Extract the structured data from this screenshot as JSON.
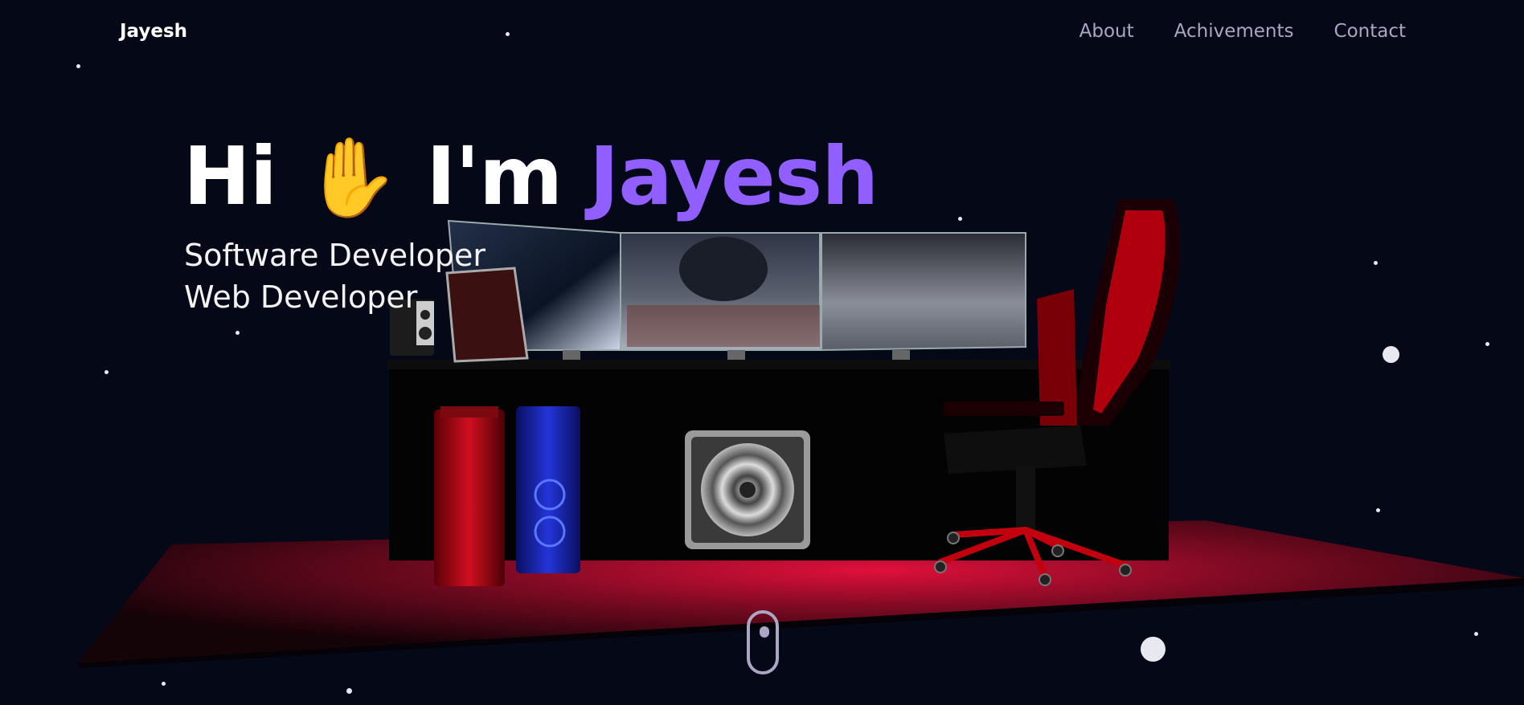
{
  "nav": {
    "logo": "Jayesh",
    "links": [
      "About",
      "Achivements",
      "Contact"
    ]
  },
  "hero": {
    "greeting": "Hi",
    "wave_icon": "waving-hand-icon",
    "intro": "I'm",
    "name": "Jayesh",
    "subtitle_line1": "Software Developer",
    "subtitle_line2": "Web Developer"
  },
  "colors": {
    "background": "#050816",
    "accent": "#915eff",
    "nav_text": "#aaa6c3",
    "floor_glow": "#e0103a"
  }
}
